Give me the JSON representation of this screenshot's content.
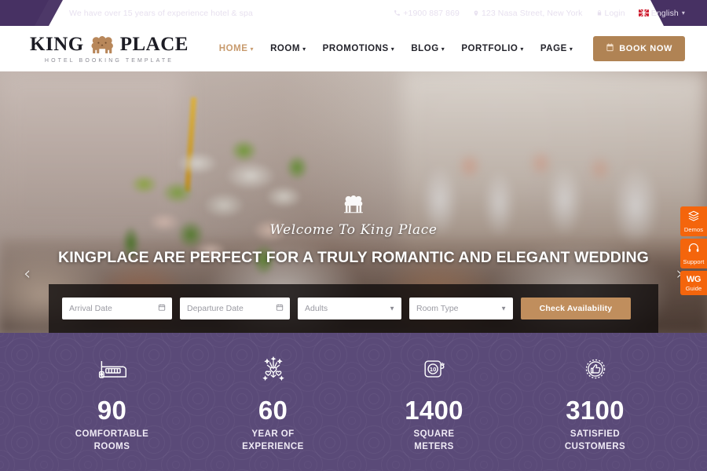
{
  "topbar": {
    "tagline": "We have over 15 years of experience hotel & spa",
    "phone": "+1900 887 869",
    "address": "123 Nasa Street, New York",
    "login": "Login",
    "language": "English"
  },
  "header": {
    "logo_word1": "KING",
    "logo_word2": "PLACE",
    "logo_sub": "HOTEL BOOKING TEMPLATE",
    "nav": [
      {
        "label": "HOME",
        "active": true
      },
      {
        "label": "ROOM",
        "active": false
      },
      {
        "label": "PROMOTIONS",
        "active": false
      },
      {
        "label": "BLOG",
        "active": false
      },
      {
        "label": "PORTFOLIO",
        "active": false
      },
      {
        "label": "PAGE",
        "active": false
      }
    ],
    "book_now": "BOOK NOW",
    "accent_color": "#c89b6e",
    "button_color": "#b08354"
  },
  "hero": {
    "script_text": "Welcome To King Place",
    "title": "KINGPLACE ARE PERFECT FOR A TRULY ROMANTIC AND ELEGANT WEDDING",
    "prev_arrow": "‹",
    "next_arrow": "›"
  },
  "booking": {
    "arrival_placeholder": "Arrival Date",
    "departure_placeholder": "Departure Date",
    "adults_placeholder": "Adults",
    "room_type_placeholder": "Room Type",
    "submit_label": "Check Availability",
    "submit_color": "#c08e5d"
  },
  "side_tabs": [
    {
      "label": "Demos",
      "icon": "layers-icon"
    },
    {
      "label": "Support",
      "icon": "headset-icon"
    },
    {
      "label": "Guide",
      "icon": "wg-logo-icon",
      "logo": "WG"
    }
  ],
  "side_tab_color": "#f4650c",
  "stats": {
    "background_color": "#5a4a78",
    "items": [
      {
        "number": "90",
        "line1": "COMFORTABLE",
        "line2": "ROOMS",
        "icon": "bed-icon"
      },
      {
        "number": "60",
        "line1": "YEAR OF",
        "line2": "EXPERIENCE",
        "icon": "fireworks-icon"
      },
      {
        "number": "1400",
        "line1": "SQUARE",
        "line2": "METERS",
        "icon": "measuring-tape-icon",
        "icon_value": "10"
      },
      {
        "number": "3100",
        "line1": "SATISFIED",
        "line2": "CUSTOMERS",
        "icon": "thumbs-up-badge-icon"
      }
    ]
  }
}
